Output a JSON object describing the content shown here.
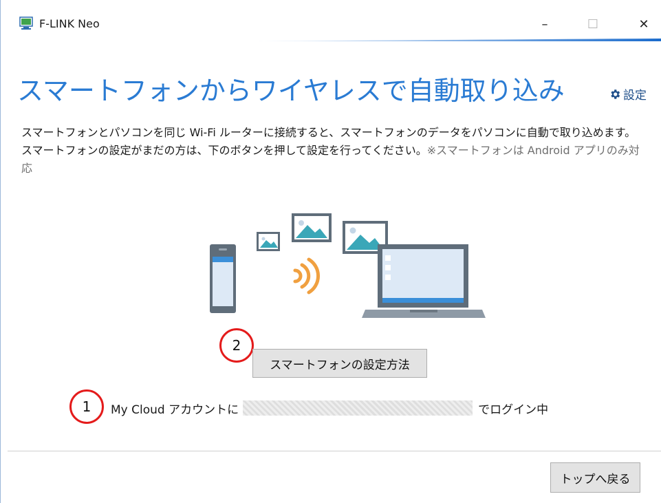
{
  "window": {
    "title": "F-LINK Neo",
    "controls": {
      "minimize": "–",
      "maximize": "☐",
      "close": "✕"
    }
  },
  "header": {
    "title": "スマートフォンからワイヤレスで自動取り込み",
    "settings_label": "設定"
  },
  "description": {
    "text": "スマートフォンとパソコンを同じ Wi-Fi ルーターに接続すると、スマートフォンのデータをパソコンに自動で取り込めます。スマートフォンの設定がまだの方は、下のボタンを押して設定を行ってください。",
    "note": "※スマートフォンは Android アプリのみ対応"
  },
  "actions": {
    "setup_button": "スマートフォンの設定方法",
    "back_button": "トップへ戻る"
  },
  "account": {
    "prefix": "My Cloud アカウントに",
    "suffix": "でログイン中"
  },
  "annotations": {
    "one": "1",
    "two": "2"
  },
  "colors": {
    "accent": "#2a7bd3",
    "swoosh": "#1d6fd0",
    "annotation": "#e41b1b",
    "wifi": "#f0a040"
  },
  "icons": {
    "app": "app-monitor-icon",
    "settings": "gear-icon"
  }
}
